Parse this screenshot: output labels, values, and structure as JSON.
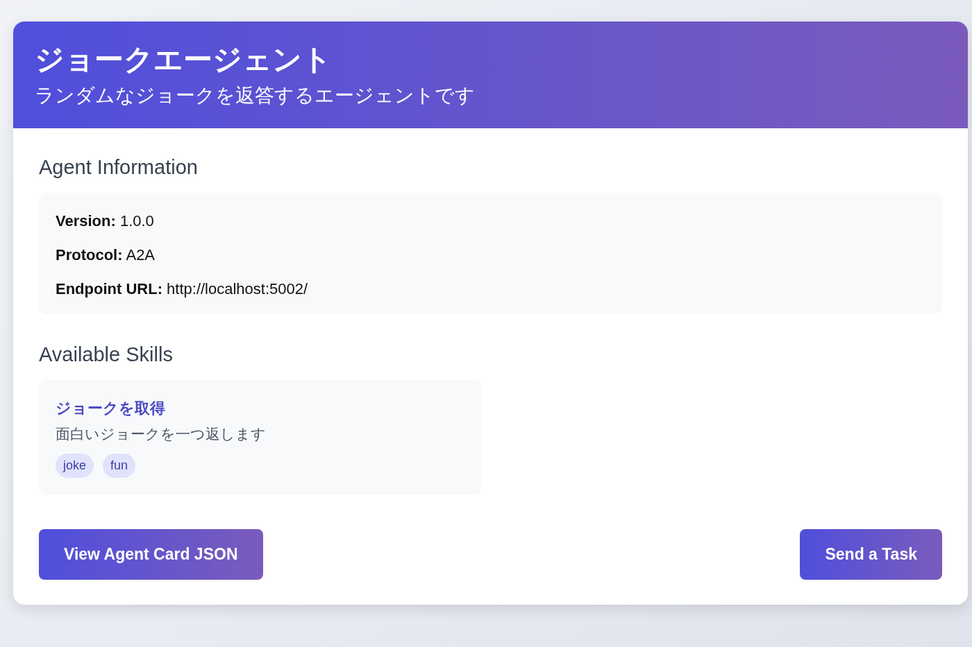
{
  "header": {
    "title": "ジョークエージェント",
    "subtitle": "ランダムなジョークを返答するエージェントです"
  },
  "agent_information": {
    "heading": "Agent Information",
    "fields": [
      {
        "text": "**Version:** 1.0.0"
      },
      {
        "text": "**Protocol:** A2A"
      },
      {
        "text": "**Endpoint URL:** http://localhost:5002/"
      }
    ]
  },
  "available_skills": {
    "heading": "Available Skills",
    "skills": [
      {
        "name": "ジョークを取得",
        "description": "面白いジョークを一つ返します",
        "tags": [
          "joke",
          "fun"
        ]
      }
    ]
  },
  "buttons": [
    {
      "label": "View Agent Card JSON"
    },
    {
      "label": "Send a Task"
    }
  ]
}
